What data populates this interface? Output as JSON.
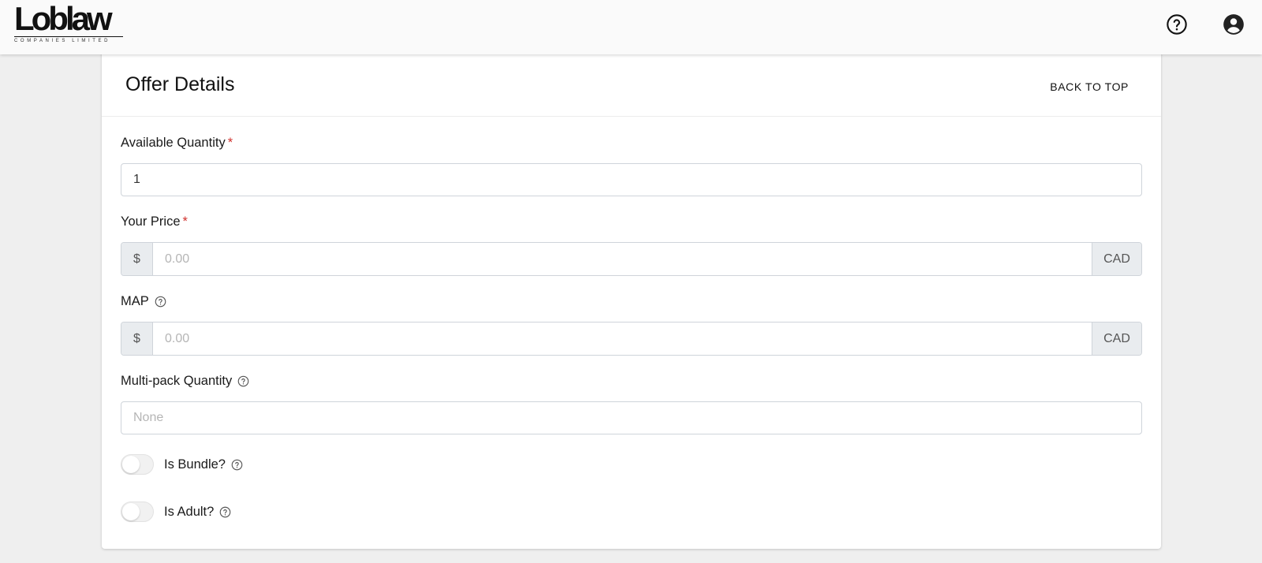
{
  "header": {
    "logo_text": "Loblaw",
    "logo_subtext": "COMPANIES LIMITED",
    "help_icon": "help-circle-icon",
    "account_icon": "account-circle-icon"
  },
  "card": {
    "title": "Offer Details",
    "back_to_top": "BACK TO TOP"
  },
  "fields": {
    "available_quantity": {
      "label": "Available Quantity",
      "required_mark": "*",
      "value": "1"
    },
    "your_price": {
      "label": "Your Price",
      "required_mark": "*",
      "prefix": "$",
      "placeholder": "0.00",
      "suffix": "CAD"
    },
    "map": {
      "label": "MAP",
      "prefix": "$",
      "placeholder": "0.00",
      "suffix": "CAD"
    },
    "multipack_quantity": {
      "label": "Multi-pack Quantity",
      "placeholder": "None"
    },
    "is_bundle": {
      "label": "Is Bundle?",
      "checked": false
    },
    "is_adult": {
      "label": "Is Adult?",
      "checked": false
    }
  },
  "colors": {
    "required": "#d0312d",
    "background": "#efefef",
    "card": "#ffffff",
    "addon": "#e9ecef"
  }
}
